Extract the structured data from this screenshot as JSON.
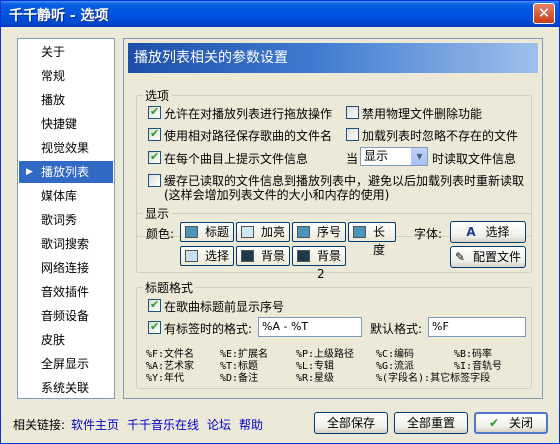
{
  "window": {
    "title": "千千静听 - 选项",
    "close": "×"
  },
  "sidebar": {
    "items": [
      {
        "label": "关于"
      },
      {
        "label": "常规"
      },
      {
        "label": "播放"
      },
      {
        "label": "快捷键"
      },
      {
        "label": "视觉效果"
      },
      {
        "label": "播放列表",
        "selected": true
      },
      {
        "label": "媒体库"
      },
      {
        "label": "歌词秀"
      },
      {
        "label": "歌词搜索"
      },
      {
        "label": "网络连接"
      },
      {
        "label": "音效插件"
      },
      {
        "label": "音频设备"
      },
      {
        "label": "皮肤"
      },
      {
        "label": "全屏显示"
      },
      {
        "label": "系统关联"
      }
    ],
    "selected_arrow": "▶"
  },
  "header": {
    "title": "播放列表相关的参数设置"
  },
  "options_group": {
    "legend": "选项",
    "allow_drag": {
      "label": "允许在对播放列表进行拖放操作",
      "checked": true
    },
    "disable_physical_delete": {
      "label": "禁用物理文件删除功能",
      "checked": false
    },
    "relative_path": {
      "label": "使用相对路径保存歌曲的文件名",
      "checked": true
    },
    "ignore_missing": {
      "label": "加载列表时忽略不存在的文件",
      "checked": false
    },
    "show_info": {
      "label": "在每个曲目上提示文件信息",
      "checked": true
    },
    "when_label": "当",
    "when_select": "显示",
    "read_info_label": "时读取文件信息",
    "cache_info": {
      "label_line1": "缓存已读取的文件信息到播放列表中，避免以后加载列表时重新读取",
      "label_line2": "(这样会增加列表文件的大小和内存的使用)",
      "checked": false
    }
  },
  "display_group": {
    "legend": "显示",
    "color_label": "颜色:",
    "colors": {
      "title": {
        "label": "标题",
        "swatch": "#4a96b8"
      },
      "highlight": {
        "label": "加亮",
        "swatch": "#cfe6f5"
      },
      "index": {
        "label": "序号",
        "swatch": "#4a96b8"
      },
      "length": {
        "label": "长度",
        "swatch": "#4a96b8"
      },
      "select": {
        "label": "选择",
        "swatch": "#c8e0f2"
      },
      "background": {
        "label": "背景",
        "swatch": "#1e3a4a"
      },
      "background2": {
        "label": "背景2",
        "swatch": "#1e3a4a"
      }
    },
    "font_label": "字体:",
    "font_select_button": "选择",
    "config_file_button": "配置文件"
  },
  "title_group": {
    "legend": "标题格式",
    "show_index": {
      "label": "在歌曲标题前显示序号",
      "checked": true
    },
    "tagged_format": {
      "label": "有标签时的格式:",
      "checked": true,
      "value": "%A - %T"
    },
    "default_format_label": "默认格式:",
    "default_format_value": "%F",
    "legend_rows": [
      [
        "%F:文件名",
        "%E:扩展名",
        "%P:上级路径",
        "%C:编码",
        "%B:码率"
      ],
      [
        "%A:艺术家",
        "%T:标题",
        "%L:专辑",
        "%G:流派",
        "%I:音轨号"
      ],
      [
        "%Y:年代",
        "%D:备注",
        "%R:星级",
        "%(字段名):其它标签字段",
        ""
      ]
    ]
  },
  "footer": {
    "related_label": "相关链接:",
    "links": [
      "软件主页",
      "千千音乐在线",
      "论坛",
      "帮助"
    ],
    "save_all": "全部保存",
    "reset_all": "全部重置",
    "close": "关闭",
    "close_check": "✔"
  }
}
